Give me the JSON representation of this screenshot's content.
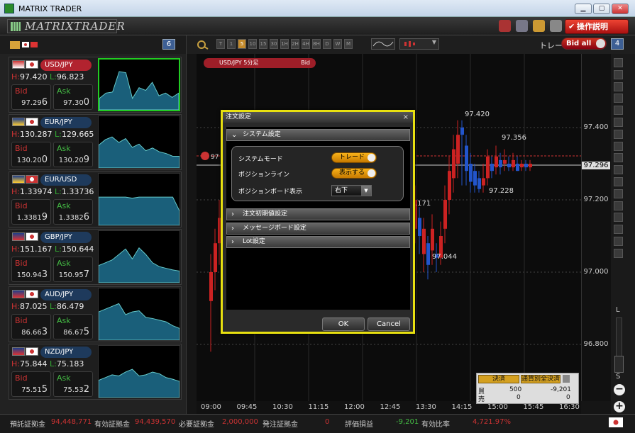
{
  "window": {
    "title": "MATRIX TRADER"
  },
  "app": {
    "logo_text": "MATRIXTRADER",
    "order_explanation_label": "操作説明"
  },
  "left_panel": {
    "pair_count": "6",
    "pairs": [
      {
        "name": "USD/JPY",
        "high": "97.420",
        "low": "96.823",
        "bid_main": "97.29",
        "bid_small": "6",
        "ask_main": "97.30",
        "ask_small": "0",
        "selected": true
      },
      {
        "name": "EUR/JPY",
        "high": "130.287",
        "low": "129.665",
        "bid_main": "130.20",
        "bid_small": "0",
        "ask_main": "130.20",
        "ask_small": "9",
        "selected": false
      },
      {
        "name": "EUR/USD",
        "high": "1.33974",
        "low": "1.33736",
        "bid_main": "1.3381",
        "bid_small": "9",
        "ask_main": "1.3382",
        "ask_small": "6",
        "selected": false
      },
      {
        "name": "GBP/JPY",
        "high": "151.167",
        "low": "150.644",
        "bid_main": "150.94",
        "bid_small": "3",
        "ask_main": "150.95",
        "ask_small": "7",
        "selected": false
      },
      {
        "name": "AUD/JPY",
        "high": "87.025",
        "low": "86.479",
        "bid_main": "86.66",
        "bid_small": "3",
        "ask_main": "86.67",
        "ask_small": "5",
        "selected": false
      },
      {
        "name": "NZD/JPY",
        "high": "75.844",
        "low": "75.183",
        "bid_main": "75.51",
        "bid_small": "5",
        "ask_main": "75.53",
        "ask_small": "2",
        "selected": false
      }
    ],
    "high_prefix": "H:",
    "low_prefix": "L:",
    "bid_label": "Bid",
    "ask_label": "Ask"
  },
  "chart": {
    "timeframes": [
      "T",
      "1",
      "5",
      "10",
      "15",
      "30",
      "1H",
      "2H",
      "4H",
      "8H",
      "D",
      "W",
      "M"
    ],
    "active_timeframe": "5",
    "trade_label": "トレード",
    "bid_all_label": "Bid all",
    "layout_number": "4",
    "tag_label": "USD/JPY 5分足",
    "tag_bid": "Bid",
    "position_marker": "97",
    "price_labels": [
      "97.400",
      "97.296",
      "97.200",
      "97.000",
      "96.800"
    ],
    "current_price": "97.296",
    "annotations": [
      "97.420",
      "97.356",
      "97.228",
      "97.044",
      ".171"
    ],
    "time_labels": [
      "09:00",
      "09:45",
      "10:30",
      "11:15",
      "12:00",
      "12:45",
      "13:30",
      "14:15",
      "15:00",
      "15:45",
      "16:30"
    ],
    "zoom_large": "L",
    "zoom_small": "S"
  },
  "position_board": {
    "settle_label": "決済",
    "settle_by_currency_label": "通貨別全決済",
    "buy_label": "買",
    "sell_label": "売",
    "buy_qty": "500",
    "buy_pl": "-9,201",
    "sell_qty": "0",
    "sell_pl": "0"
  },
  "dialog": {
    "title": "注文設定",
    "close_label": "×",
    "sections": {
      "system": "システム設定",
      "order_initial": "注文初期値設定",
      "message_board": "メッセージボード設定",
      "lot": "Lot設定"
    },
    "system_mode_label": "システムモード",
    "system_mode_value": "トレード",
    "position_line_label": "ポジションライン",
    "position_line_value": "表示する",
    "position_board_label": "ポジションボード表示",
    "position_board_value": "右下",
    "ok_label": "OK",
    "cancel_label": "Cancel"
  },
  "status_bar": {
    "deposit_label": "預託証拠金",
    "deposit_value": "94,448,771",
    "effective_label": "有効証拠金",
    "effective_value": "94,439,570",
    "required_label": "必要証拠金",
    "required_value": "2,000,000",
    "ordered_label": "発注証拠金",
    "ordered_value": "0",
    "pl_label": "評価損益",
    "pl_value": "-9,201",
    "ratio_label": "有効比率",
    "ratio_value": "4,721.97%"
  },
  "colors": {
    "bid": "#cc3333",
    "ask": "#44bb44",
    "accent_yellow": "#e8e010",
    "toggle_orange": "#f8b21a",
    "candle_up": "#2255cc",
    "candle_down": "#cc2222"
  }
}
